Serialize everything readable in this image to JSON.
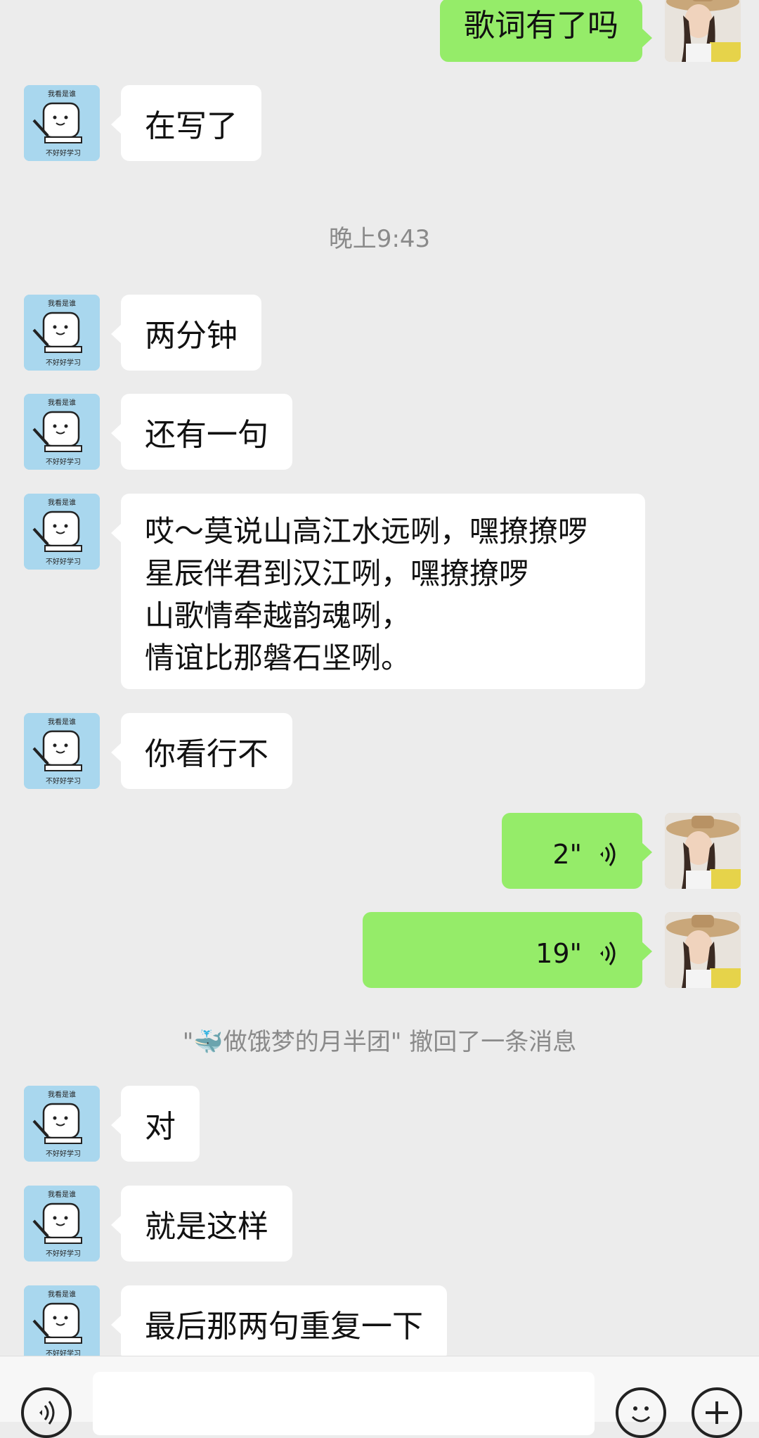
{
  "messages": {
    "m1": "歌词有了吗",
    "m2": "在写了",
    "time": "晚上9:43",
    "m3": "两分钟",
    "m4": "还有一句",
    "m5": [
      "哎～莫说山高江水远咧，嘿撩撩啰",
      "星辰伴君到汉江咧，嘿撩撩啰",
      "山歌情牵越韵魂咧，",
      "情谊比那磐石坚咧。"
    ],
    "m6": "你看行不",
    "voice1": "2\"",
    "voice2": "19\"",
    "recall": "\"🐳做饿梦的月半团\" 撤回了一条消息",
    "m7": "对",
    "m8": "就是这样",
    "m9": "最后那两句重复一下"
  },
  "avatar_text": {
    "top": "我看是谁",
    "bottom": "不好好学习"
  },
  "icons": [
    "voice-mode-icon",
    "emoji-icon",
    "add-icon",
    "voice-wave-icon"
  ],
  "colors": {
    "background": "#ececec",
    "incoming": "#ffffff",
    "outgoing": "#95ec69"
  }
}
